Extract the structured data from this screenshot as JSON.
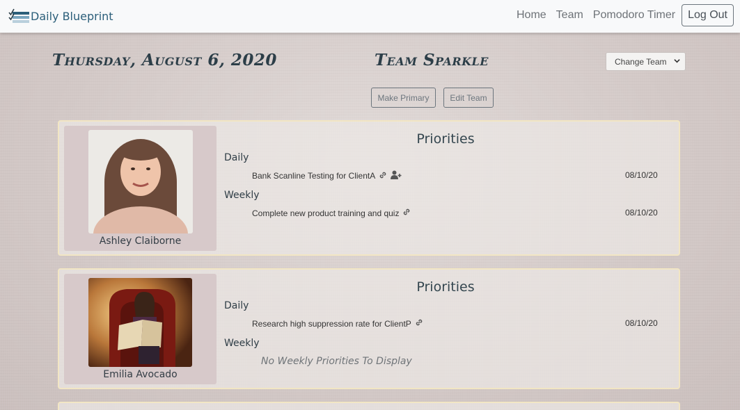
{
  "app": {
    "brand": "Daily Blueprint",
    "nav": [
      "Home",
      "Team",
      "Pomodoro Timer"
    ],
    "logout_label": "Log Out"
  },
  "header": {
    "date": "Thursday, August 6, 2020",
    "team_name": "Team Sparkle",
    "team_select": "Change Team",
    "make_primary_label": "Make Primary",
    "edit_team_label": "Edit Team"
  },
  "members": [
    {
      "name": "Ashley Claiborne",
      "priorities_heading": "Priorities",
      "daily_label": "Daily",
      "daily": [
        {
          "text": "Bank Scanline Testing for ClientA",
          "date": "08/10/20",
          "icons": [
            "link-icon",
            "user-plus-icon"
          ]
        }
      ],
      "weekly_label": "Weekly",
      "weekly": [
        {
          "text": "Complete new product training and quiz",
          "date": "08/10/20",
          "icons": [
            "link-icon"
          ]
        }
      ]
    },
    {
      "name": "Emilia Avocado",
      "priorities_heading": "Priorities",
      "daily_label": "Daily",
      "daily": [
        {
          "text": "Research high suppression rate for ClientP",
          "date": "08/10/20",
          "icons": [
            "link-icon"
          ]
        }
      ],
      "weekly_label": "Weekly",
      "weekly_empty": "No Weekly Priorities To Display"
    }
  ],
  "colors": {
    "brand": "#2c5f7a",
    "card_border": "#f2e6c4",
    "profile_bg": "#d7c9ca",
    "heading": "#2c3e48"
  }
}
